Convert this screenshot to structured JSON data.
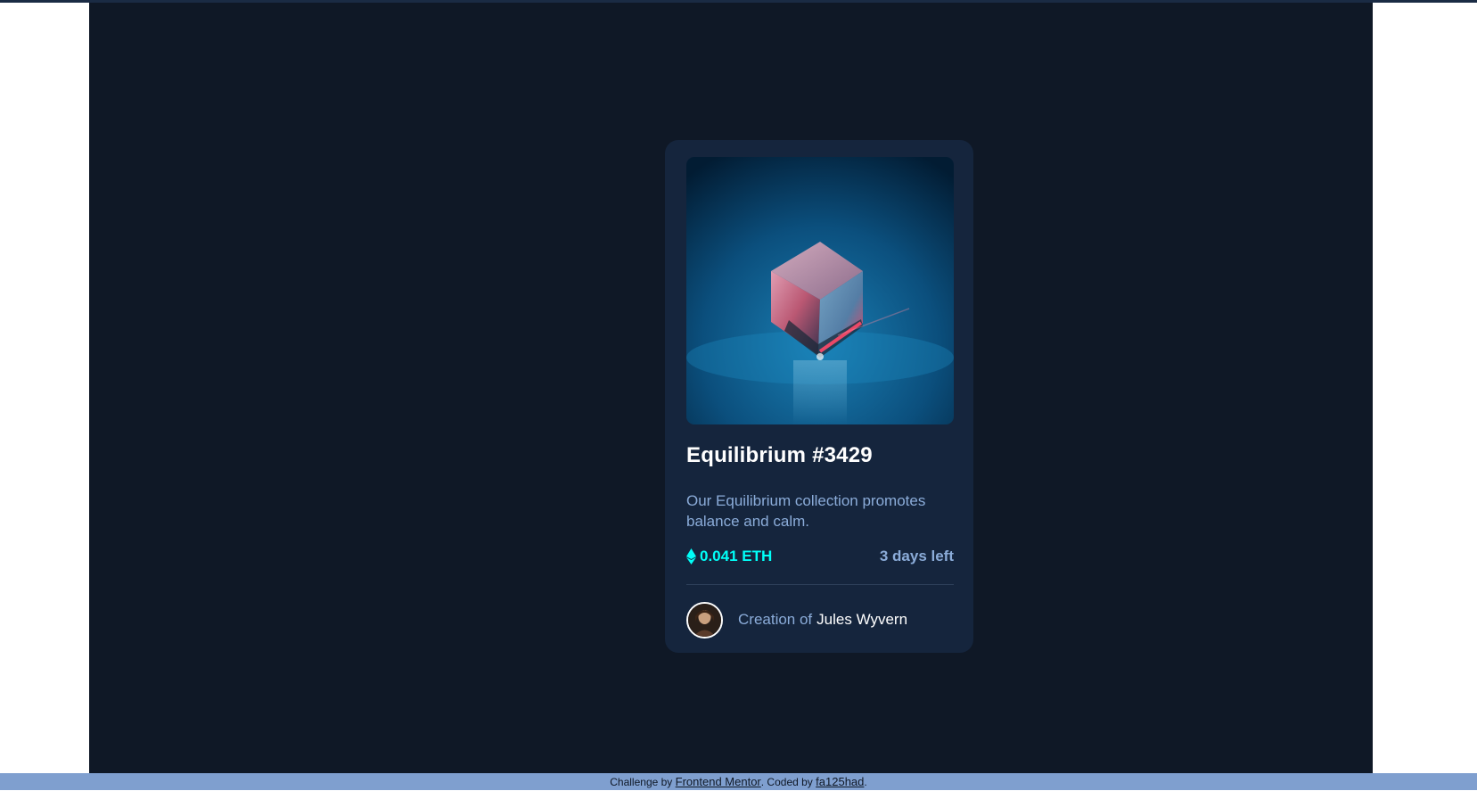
{
  "card": {
    "title": "Equilibrium #3429",
    "description": "Our Equilibrium collection promotes balance and calm.",
    "price": "0.041 ETH",
    "time_left": "3 days left",
    "creation_label": "Creation of",
    "creator_name": "Jules Wyvern",
    "image_icon": "cube-image",
    "price_icon": "ethereum-icon",
    "avatar_icon": "avatar-portrait"
  },
  "footer": {
    "prefix": "Challenge by",
    "challenge_link": "Frontend Mentor",
    "middle": ". Coded by",
    "coder_link": "fa125had",
    "suffix": "."
  },
  "colors": {
    "page_bg": "#0f1826",
    "card_bg": "#15253d",
    "accent_cyan": "#00fff8",
    "soft_blue": "#8bacd9",
    "footer_bg": "#7f9fcf"
  }
}
